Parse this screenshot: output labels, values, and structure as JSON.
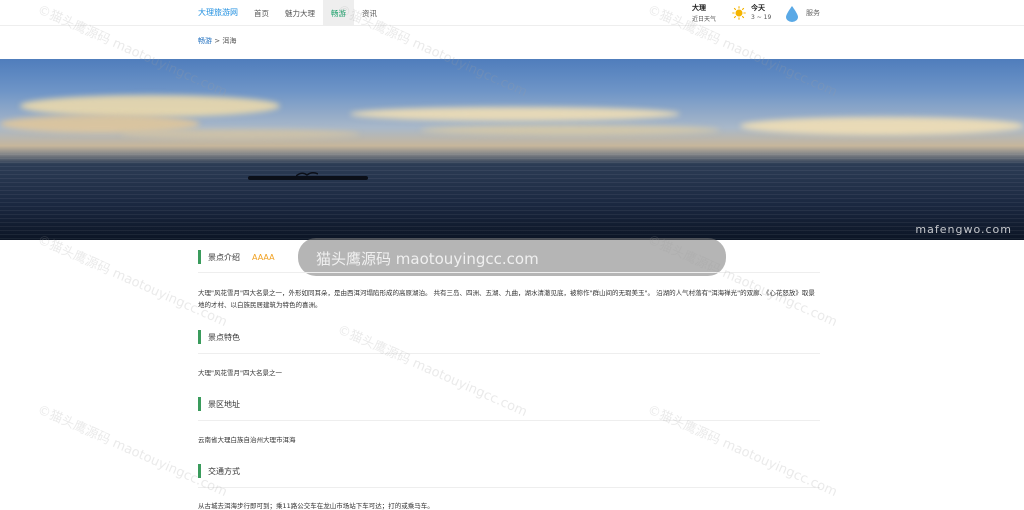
{
  "header": {
    "brand": "大理旅游网",
    "nav": [
      {
        "label": "首页",
        "active": false
      },
      {
        "label": "魅力大理",
        "active": false
      },
      {
        "label": "畅游",
        "active": true
      },
      {
        "label": "资讯",
        "active": false
      }
    ],
    "weather": {
      "city": "大理",
      "label": "近日天气",
      "today": "今天",
      "temp": "3 ~ 19"
    },
    "service": "服务"
  },
  "breadcrumb": {
    "first": "畅游",
    "sep": ">",
    "current": "洱海"
  },
  "banner": {
    "watermark": "mafengwo.com"
  },
  "overlay": {
    "text": "猫头鹰源码 maotouyingcc.com"
  },
  "sections": {
    "intro": {
      "title": "景点介绍",
      "rating": "AAAA",
      "body": "大理\"风花雪月\"四大名景之一，外形如同耳朵，是由西洱河塌陷形成的高原湖泊。 共有三岛、四洲、五湖、九曲，湖水清澈见底，被称作\"群山间的无瑕美玉\"。 沿湖的人气村落有\"洱海禅光\"的双廊、《心花怒放》取景地的才村、以白族民居建筑为特色的喜洲。"
    },
    "feature": {
      "title": "景点特色",
      "body": "大理\"风花雪月\"四大名景之一"
    },
    "address": {
      "title": "景区地址",
      "body": "云南省大理白族自治州大理市洱海"
    },
    "traffic": {
      "title": "交通方式",
      "body": "从古城去洱海步行即可到；乘11路公交车在龙山市场站下车可达；打的或乘马车。"
    }
  },
  "watermark_text": "©猫头鹰源码 maotouyingcc.com",
  "colors": {
    "accent": "#3a9b5c",
    "brand": "#1f8fe0",
    "rating": "#f0a020"
  }
}
